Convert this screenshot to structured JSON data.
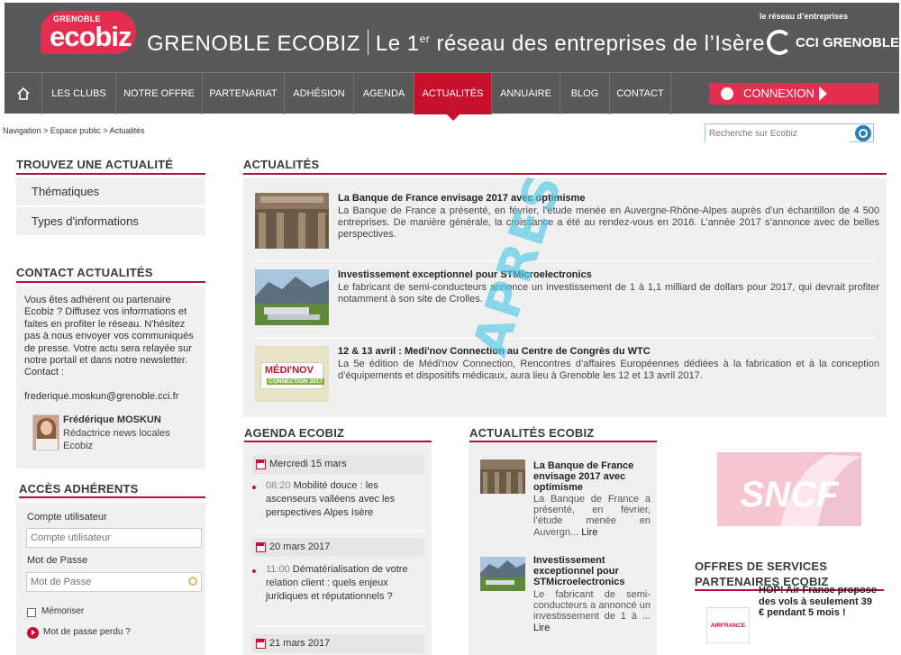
{
  "header": {
    "logo_small": "GRENOBLE",
    "logo_big": "ecobiz",
    "title_part1": "GRENOBLE  ECOBIZ",
    "title_part2_pre": "Le 1",
    "title_part2_sup": "er",
    "title_part2_post": " réseau des entreprises de l’Isère",
    "cci_tagline": "le réseau d’entreprises",
    "cci_name": "CCI GRENOBLE"
  },
  "nav": {
    "items": [
      "LES CLUBS",
      "NOTRE OFFRE",
      "PARTENARIAT",
      "ADHÉSION",
      "AGENDA",
      "ACTUALITÉS",
      "ANNUAIRE",
      "BLOG",
      "CONTACT"
    ],
    "active": "ACTUALITÉS",
    "connexion_label": "CONNEXION"
  },
  "breadcrumb": "Navigation > Espace public > Actualités",
  "search": {
    "placeholder": "Recherche sur Ecobiz"
  },
  "sidebar": {
    "find_title": "TROUVEZ UNE ACTUALITÉ",
    "find_items": [
      "Thématiques",
      "Types d'informations"
    ],
    "contact_title": "CONTACT ACTUALITÉS",
    "contact_text": "Vous êtes adhérent ou partenaire Ecobiz ? Diffusez vos informations et faites en profiter le réseau. N'hésitez pas à nous envoyer vos communiqués de presse. Votre actu sera relayée sur notre portail et dans notre newsletter. Contact :",
    "contact_email": "frederique.moskun@grenoble.cci.fr",
    "contact_name": "Frédérique MOSKUN",
    "contact_role": "Rédactrice news locales Ecobiz",
    "login_title": "ACCÈS ADHÉRENTS",
    "user_label": "Compte utilisateur",
    "user_placeholder": "Compte utilisateur",
    "pass_label": "Mot de Passe",
    "pass_placeholder": "Mot de Passe",
    "remember_label": "Mémoriser",
    "lost_label": "Mot de passe perdu ?"
  },
  "news": {
    "title": "ACTUALITÉS",
    "stamp": "APRES",
    "items": [
      {
        "title": "La Banque de France envisage 2017 avec optimisme",
        "body": "La Banque de France a présenté, en février, l’étude menée en Auvergne-Rhône-Alpes auprès d’un échantillon de 4 500 entreprises. De manière générale, la croissance a été au rendez-vous en 2016. L’année 2017 s’annonce avec de belles perspectives."
      },
      {
        "title": "Investissement exceptionnel pour STMicroelectronics",
        "body": "Le fabricant de semi-conducteurs annonce un investissement de 1 à 1,1 milliard de dollars pour 2017, qui devrait profiter notamment à son site de Crolles."
      },
      {
        "title": "12 & 13 avril : Medi'nov Connection au Centre de Congrès du WTC",
        "body": "La 5e édition de Médi'nov Connection, Rencontres d’affaires Européennes dédiées à la fabrication et à la conception d’équipements et dispositifs médicaux, aura lieu à Grenoble les 12 et 13 avril 2017."
      }
    ],
    "medinov_thumb_text1": "MÉDI'NOV",
    "medinov_thumb_text2": "CONNECTION 2017"
  },
  "agenda": {
    "title": "AGENDA ECOBIZ",
    "entries": [
      {
        "date": "Mercredi 15 mars",
        "time": "08:20",
        "text": "Mobilité douce : les ascenseurs valléens avec les perspectives Alpes Isère"
      },
      {
        "date": "20 mars 2017",
        "time": "11:00",
        "text": "Dématérialisation de votre relation client : quels enjeux juridiques et réputationnels ?"
      },
      {
        "date": "21 mars 2017"
      }
    ]
  },
  "ecobiz_news": {
    "title": "ACTUALITÉS ECOBIZ",
    "items": [
      {
        "title": "La Banque de France envisage 2017 avec optimisme",
        "body": "La Banque de France a présenté, en février, l’étude menée en Auvergn...",
        "lire": "Lire"
      },
      {
        "title": "Investissement exceptionnel pour STMicroelectronics",
        "body": "Le fabricant de semi-conducteurs a annoncé un investissement de 1 à ...",
        "lire": "Lire"
      }
    ]
  },
  "partners": {
    "sncf_logo": "SNCF",
    "offres_title": "OFFRES DE SERVICES PARTENAIRES ECOBIZ",
    "af_logo": "AIRFRANCE",
    "af_text": "HOP! Air France propose des vols à seulement 39 € pendant 5 mois !"
  },
  "colors": {
    "brand_red": "#c8102e",
    "header_gray": "#58595b",
    "panel_gray": "#f0f0f0"
  }
}
